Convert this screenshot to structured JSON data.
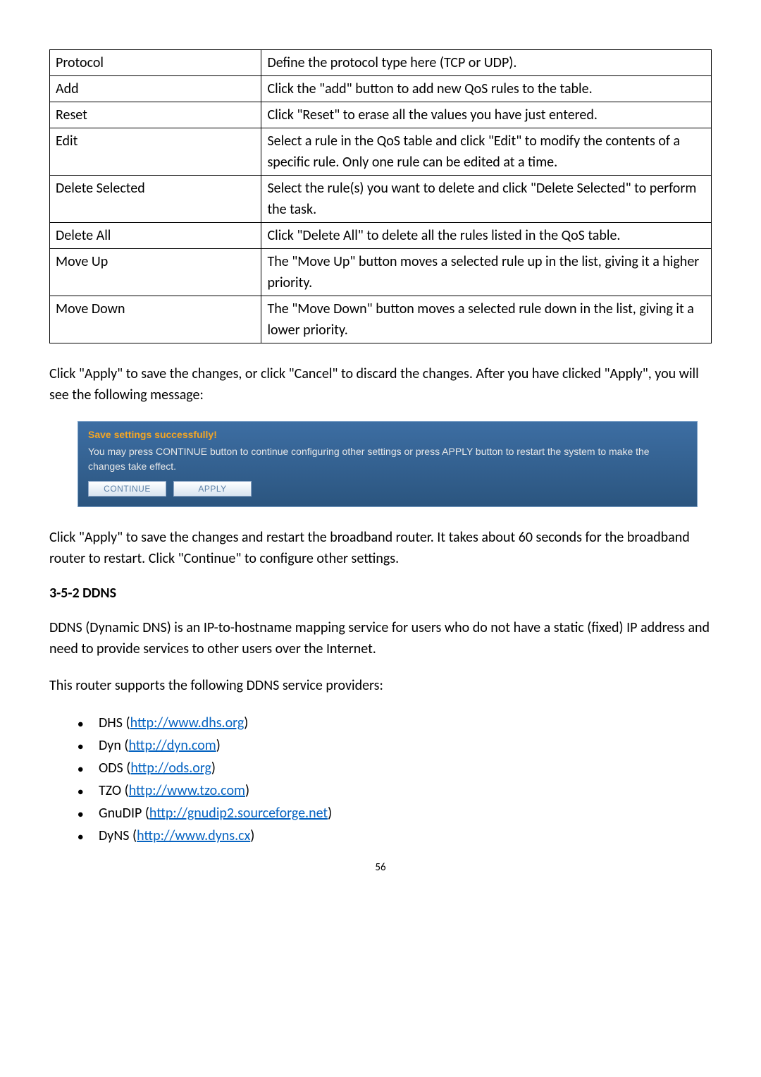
{
  "table": {
    "rows": [
      {
        "k": "Protocol",
        "v": "Define the protocol type here (TCP or UDP)."
      },
      {
        "k": "Add",
        "v": "Click the \"add\" button to add new QoS rules to the table."
      },
      {
        "k": "Reset",
        "v": "Click \"Reset\" to erase all the values you have just entered."
      },
      {
        "k": "Edit",
        "v": "Select a rule in the QoS table and click \"Edit\" to modify the contents of a specific rule. Only one rule can be edited at a time."
      },
      {
        "k": "Delete Selected",
        "v": "Select the rule(s) you want to delete and click \"Delete Selected\" to perform the task."
      },
      {
        "k": "Delete All",
        "v": "Click \"Delete All\" to delete all the rules listed in the QoS table."
      },
      {
        "k": "Move Up",
        "v": "The \"Move Up\" button moves a selected rule up in the list, giving it a higher priority."
      },
      {
        "k": "Move Down",
        "v": "The \"Move Down\" button moves a selected rule down in the list, giving it a lower priority."
      }
    ]
  },
  "para1": "Click \"Apply\" to save the changes, or click \"Cancel\" to discard the changes. After you have clicked \"Apply\", you will see the following message:",
  "notice": {
    "title": "Save settings successfully!",
    "body": "You may press CONTINUE button to continue configuring other settings or press APPLY button to restart the system to make the changes take effect.",
    "continue": "CONTINUE",
    "apply": "APPLY"
  },
  "para2": "Click \"Apply\" to save the changes and restart the broadband router. It takes about 60 seconds for the broadband router to restart. Click \"Continue\" to configure other settings.",
  "section_heading": "3-5-2 DDNS",
  "para3": "DDNS (Dynamic DNS) is an IP-to-hostname mapping service for users who do not have a static (fixed) IP address and need to provide services to other users over the Internet.",
  "para4": "This router supports the following DDNS service providers:",
  "providers": [
    {
      "name": "DHS",
      "url": "http://www.dhs.org"
    },
    {
      "name": "Dyn",
      "url": "http://dyn.com"
    },
    {
      "name": "ODS",
      "url": "http://ods.org"
    },
    {
      "name": "TZO",
      "url": "http://www.tzo.com"
    },
    {
      "name": "GnuDIP",
      "url": "http://gnudip2.sourceforge.net"
    },
    {
      "name": "DyNS",
      "url": "http://www.dyns.cx"
    }
  ],
  "page_number": "56"
}
